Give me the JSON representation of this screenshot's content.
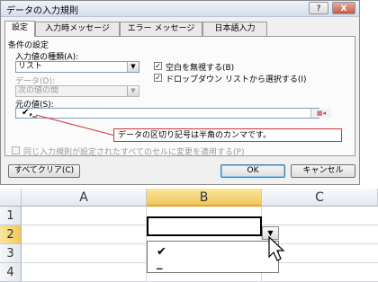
{
  "dialog": {
    "title": "データの入力規則",
    "help_label": "?",
    "close_label": "X",
    "tabs": [
      {
        "label": "設定"
      },
      {
        "label": "入力時メッセージ"
      },
      {
        "label": "エラー メッセージ"
      },
      {
        "label": "日本語入力"
      }
    ],
    "conditions_heading": "条件の設定",
    "allow_label": "入力値の種類(A):",
    "allow_value": "リスト",
    "data_label": "データ(D):",
    "data_value": "次の値の間",
    "ignore_blank_label": "空白を無視する(B)",
    "dropdown_label": "ドロップダウン リストから選択する(I)",
    "ignore_blank_checked": "✓",
    "dropdown_checked": "✓",
    "source_label": "元の値(S):",
    "source_value": "✔,_",
    "apply_all_label": "同じ入力規則が設定されたすべてのセルに変更を適用する(P)",
    "clear_all_button": "すべてクリア(C)",
    "ok_button": "OK",
    "cancel_button": "キャンセル"
  },
  "annotation": {
    "text": "データの区切り記号は半角のカンマです。",
    "color": "#d23030"
  },
  "sheet": {
    "columns": [
      "A",
      "B",
      "C"
    ],
    "rows": [
      "1",
      "2",
      "3",
      "4"
    ],
    "selected_column": "B",
    "selected_row": "2",
    "dropdown_items": [
      "✔",
      "_"
    ],
    "highlight_color": "#f1c85a"
  }
}
